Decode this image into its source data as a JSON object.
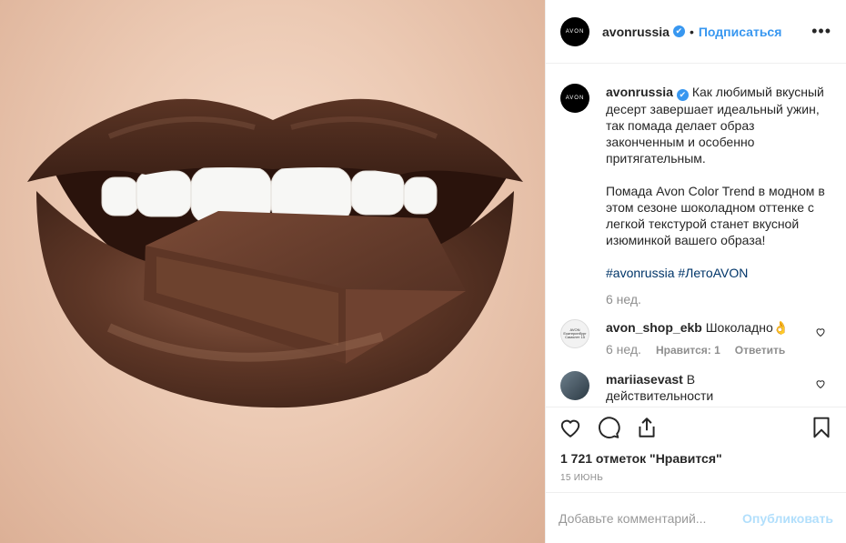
{
  "header": {
    "avatar_text": "AVON",
    "username": "avonrussia",
    "verified_glyph": "✔",
    "separator": "•",
    "follow_label": "Подписаться",
    "more_glyph": "•••"
  },
  "caption": {
    "avatar_text": "AVON",
    "username": "avonrussia",
    "text": "Как любимый вкусный десерт завершает идеальный ужин, так помада делает образ законченным и особенно притягательным.\n\nПомада Avon Color Trend в модном в этом сезоне шоколадном оттенке с легкой текстурой станет вкусной изюминкой вашего образа!",
    "hashtags": "#avonrussia #ЛетоAVON",
    "age": "6 нед."
  },
  "comments": [
    {
      "avatar_text": "AVON Екатеринбург Самолет 15",
      "username": "avon_shop_ekb",
      "text": "Шоколадно👌",
      "age": "6 нед.",
      "likes_label": "Нравится: 1",
      "reply_label": "Ответить"
    },
    {
      "username": "mariiasevast",
      "text": "В действительности"
    }
  ],
  "actions": {
    "like_icon": "heart-icon",
    "comment_icon": "comment-icon",
    "share_icon": "share-icon",
    "save_icon": "bookmark-icon"
  },
  "likes_text": "1 721 отметок \"Нравится\"",
  "date_text": "15 ИЮНЬ",
  "add_comment": {
    "placeholder": "Добавьте комментарий...",
    "publish_label": "Опубликовать"
  },
  "colors": {
    "accent": "#3897f0",
    "hashtag": "#003569",
    "muted": "#8e8e8e",
    "publish_disabled": "#b2dffc"
  }
}
